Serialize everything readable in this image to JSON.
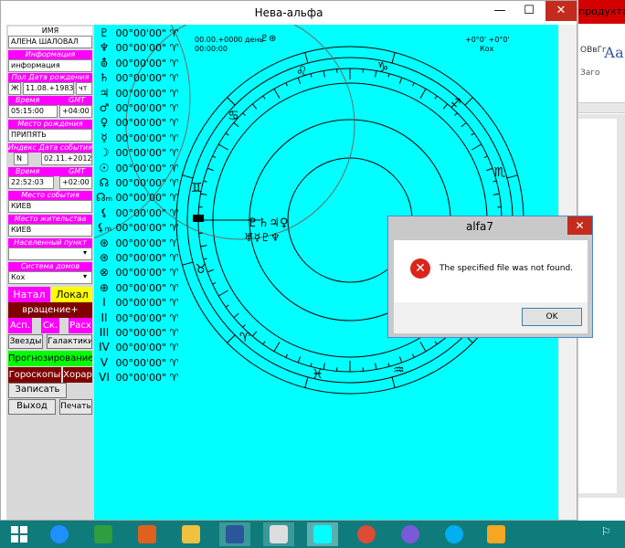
{
  "window": {
    "title": "Нева-альфа",
    "min_glyph": "—",
    "max_glyph": "☐",
    "close_glyph": "✕"
  },
  "background_app": {
    "red_text": "продукта",
    "ribbon_text": "ОВвГг,",
    "style_sample": "Аа",
    "tab_text": "Заго"
  },
  "left_panel": {
    "name_label": "ИМЯ",
    "name_value": "АЛЕНА ШАЛОВАЛ",
    "info_label": "Информация",
    "info_value": "информация",
    "birth_header": "Пол  Дата рождения",
    "sex_value": "Ж",
    "birth_date": "11.08.+1983",
    "weekday": "чт",
    "time_label": "Время",
    "gmt_label": "GMT",
    "birth_time": "05:15:00",
    "birth_gmt": "+04:00",
    "birthplace_label": "Место рождения",
    "birthplace_value": "ПРИПЯТЬ",
    "event_header": "Индекс  Дата события",
    "index_value": "N",
    "event_date": "02.11.+2012",
    "event_time_label": "Время",
    "event_gmt_label": "GMT",
    "event_time": "22:52:03",
    "event_gmt": "+02:00",
    "event_place_label": "Место события",
    "event_place_value": "КИЕВ",
    "residence_label": "Место жительства",
    "residence_value": "КИЕВ",
    "locality_label": "Населенный пункт",
    "locality_value": "",
    "house_system_label": "Система домов",
    "house_system_value": "Кох",
    "btn_natal": "Натал",
    "btn_local": "Локал",
    "btn_rotation": "вращение+",
    "btn_asp": "Асп.",
    "btn_sk": "Ск.",
    "btn_rask": "Расх",
    "btn_stars": "Звезды",
    "btn_galaxies": "Галактики",
    "btn_forecast": "Прогнозирование",
    "btn_horoscopes": "Гороскопы",
    "btn_horar": "Хорар",
    "btn_save": "Записать",
    "btn_exit": "Выход",
    "btn_print": "Печать"
  },
  "chart_header": {
    "left_line1": "00.00.+0000 день",
    "left_line2": "00:00:00",
    "right_line1": "+0°0' +0°0'",
    "right_line2": "Кох"
  },
  "planets": [
    {
      "glyph": "♇",
      "value": "00°00'00\" ♈"
    },
    {
      "glyph": "♆",
      "value": "00°00'00\" ♈"
    },
    {
      "glyph": "⛢",
      "value": "00°00'00\" ♈"
    },
    {
      "glyph": "♄",
      "value": "00°00'00\" ♈"
    },
    {
      "glyph": "♃",
      "value": "00°00'00\" ♈"
    },
    {
      "glyph": "♂",
      "value": "00°00'00\" ♈"
    },
    {
      "glyph": "♀",
      "value": "00°00'00\" ♈"
    },
    {
      "glyph": "☿",
      "value": "00°00'00\" ♈"
    },
    {
      "glyph": "☽",
      "value": "00°00'00\" ♈"
    },
    {
      "glyph": "☉",
      "value": "00°00'00\" ♈"
    },
    {
      "glyph": "☊",
      "value": "00°00'00\" ♈"
    },
    {
      "glyph": "☊ₘ",
      "value": "00°00'00\" ♈"
    },
    {
      "glyph": "⚸",
      "value": "00°00'00\" ♈"
    },
    {
      "glyph": "⚸ₘ",
      "value": "00°00'00\" ♈"
    },
    {
      "glyph": "⊛",
      "value": "00°00'00\" ♈"
    },
    {
      "glyph": "⊛",
      "value": "00°00'00\" ♈"
    },
    {
      "glyph": "⊗",
      "value": "00°00'00\" ♈"
    },
    {
      "glyph": "⊕",
      "value": "00°00'00\" ♈"
    },
    {
      "glyph": "I",
      "value": "00°00'00\" ♈"
    },
    {
      "glyph": "II",
      "value": "00°00'00\" ♈"
    },
    {
      "glyph": "III",
      "value": "00°00'00\" ♈"
    },
    {
      "glyph": "IV",
      "value": "00°00'00\" ♈"
    },
    {
      "glyph": "V",
      "value": "00°00'00\" ♈"
    },
    {
      "glyph": "VI",
      "value": "00°00'00\" ♈"
    }
  ],
  "chart_glyphs": {
    "header_planets": "♇⊛",
    "cluster_top": "♇♄♃♀",
    "cluster_bottom": "♅☿♇♆",
    "zodiac": [
      "♑",
      "♐",
      "♏",
      "♎",
      "♍",
      "♒",
      "♓",
      "♈",
      "♉",
      "♊",
      "♋",
      "♌"
    ]
  },
  "dialog": {
    "title": "alfa7",
    "message": "The specified file was not found.",
    "ok": "OK",
    "icon": "✕"
  },
  "colors": {
    "chart_bg": "#00ffff",
    "label_bg": "#ff00ff",
    "natal_bg": "#ff00ff",
    "local_bg": "#ffff00",
    "rotation_bg": "#800000",
    "forecast_bg": "#00ff00",
    "horoscope_bg": "#800000",
    "taskbar": "#0f7b7b"
  }
}
